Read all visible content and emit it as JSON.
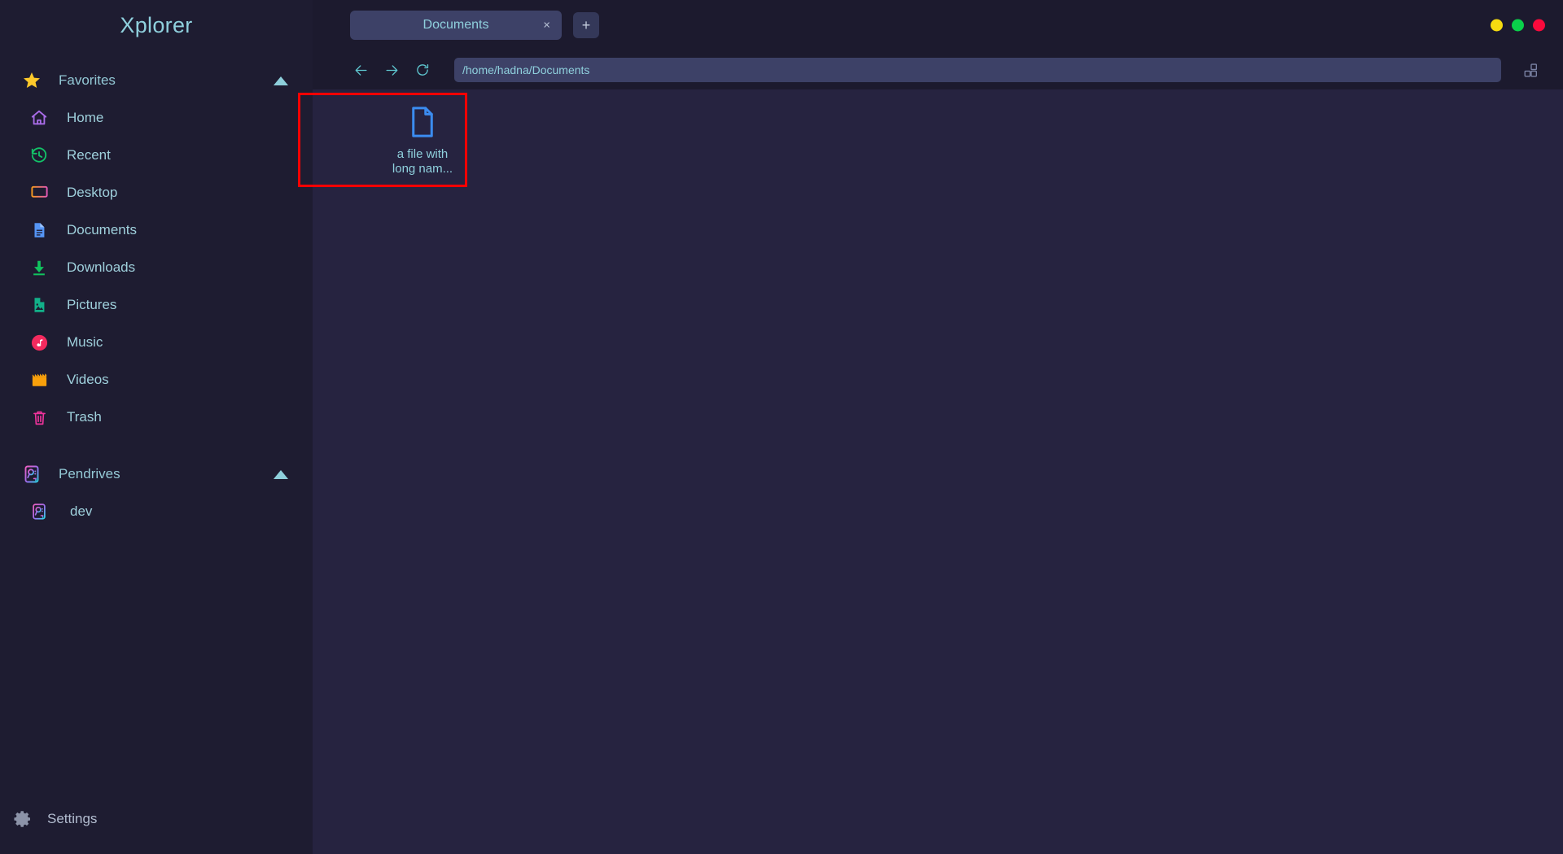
{
  "app": {
    "title": "Xplorer"
  },
  "sidebar": {
    "favorites": {
      "label": "Favorites",
      "icon": "star-icon",
      "collapse_icon": "triangle-up-icon",
      "items": [
        {
          "label": "Home",
          "icon": "home-icon"
        },
        {
          "label": "Recent",
          "icon": "history-clock-icon"
        },
        {
          "label": "Desktop",
          "icon": "monitor-icon"
        },
        {
          "label": "Documents",
          "icon": "document-icon"
        },
        {
          "label": "Downloads",
          "icon": "download-arrow-icon"
        },
        {
          "label": "Pictures",
          "icon": "image-file-icon"
        },
        {
          "label": "Music",
          "icon": "music-note-icon"
        },
        {
          "label": "Videos",
          "icon": "clapperboard-icon"
        },
        {
          "label": "Trash",
          "icon": "trash-icon"
        }
      ]
    },
    "pendrives": {
      "label": "Pendrives",
      "icon": "pendrive-icon",
      "collapse_icon": "triangle-up-icon",
      "items": [
        {
          "label": "dev",
          "icon": "pendrive-icon"
        }
      ]
    },
    "settings": {
      "label": "Settings",
      "icon": "gear-icon"
    }
  },
  "tabs": {
    "items": [
      {
        "label": "Documents",
        "close_label": "×"
      }
    ],
    "add_label": "+"
  },
  "window_controls": {
    "minimize_color": "#f5db10",
    "maximize_color": "#0ad14a",
    "close_color": "#fa0a3c"
  },
  "pathbar": {
    "back_icon": "arrow-left-icon",
    "forward_icon": "arrow-right-icon",
    "refresh_icon": "refresh-icon",
    "path_value": "/home/hadna/Documents",
    "path_placeholder": "/home/hadna/Documents",
    "view_toggle_icon": "grid-view-icon"
  },
  "files": {
    "items": [
      {
        "name": "a file with long nam...",
        "icon": "file-document-icon",
        "selected": true
      }
    ]
  },
  "colors": {
    "sidebar_bg": "#1e1c31",
    "main_bg": "#1c1a2e",
    "content_bg": "#262340",
    "accent_text": "#8fd0dd",
    "tab_bg": "#3d4167",
    "selection_outline": "#ff0000"
  }
}
